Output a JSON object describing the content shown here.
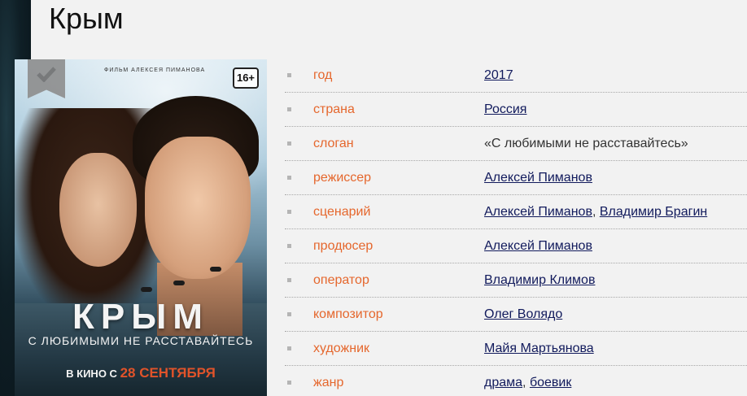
{
  "page": {
    "title": "Крым"
  },
  "poster": {
    "credit": "ФИЛЬМ АЛЕКСЕЯ ПИМАНОВА",
    "rating": "16+",
    "title": "КРЫМ",
    "tagline": "С ЛЮБИМЫМИ НЕ РАССТАВАЙТЕСЬ",
    "release_prefix": "В КИНО С",
    "release_date": "28 СЕНТЯБРЯ",
    "bookmark_icon": "checkmark-icon"
  },
  "info": {
    "year_label": "год",
    "year_value": "2017",
    "country_label": "страна",
    "country_value": "Россия",
    "slogan_label": "слоган",
    "slogan_value": "«С любимыми не расставайтесь»",
    "director_label": "режиссер",
    "director_value": "Алексей Пиманов",
    "writer_label": "сценарий",
    "writer_value_1": "Алексей Пиманов",
    "writer_sep": ",",
    "writer_value_2": "Владимир Брагин",
    "producer_label": "продюсер",
    "producer_value": "Алексей Пиманов",
    "operator_label": "оператор",
    "operator_value": "Владимир Климов",
    "composer_label": "композитор",
    "composer_value": "Олег Волядо",
    "artist_label": "художник",
    "artist_value": "Майя Мартьянова",
    "genre_label": "жанр",
    "genre_value_1": "драма",
    "genre_sep": ",",
    "genre_value_2": "боевик"
  },
  "colors": {
    "label": "#e5672d",
    "link": "#111a5c",
    "background": "#f2f2f2"
  }
}
